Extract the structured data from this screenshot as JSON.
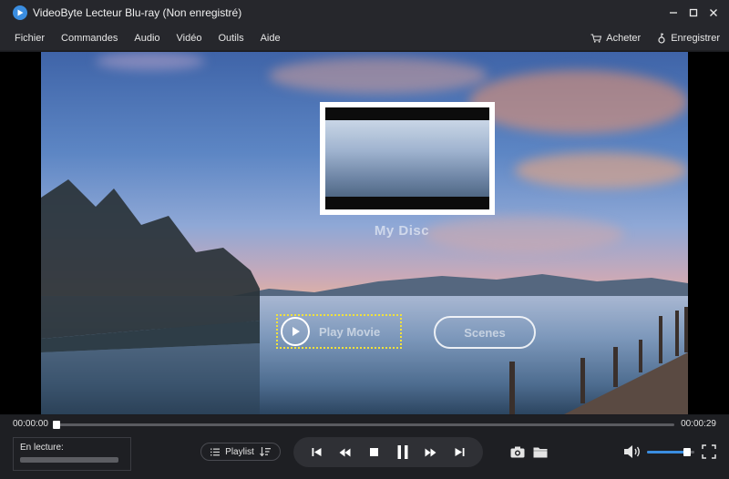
{
  "window": {
    "title": "VideoByte Lecteur Blu-ray (Non enregistré)",
    "controls": {
      "minimize": "—",
      "maximize": "☐",
      "close": "✕"
    }
  },
  "menu": {
    "items": [
      "Fichier",
      "Commandes",
      "Audio",
      "Vidéo",
      "Outils",
      "Aide"
    ],
    "buy_label": "Acheter",
    "register_label": "Enregistrer"
  },
  "disc_menu": {
    "title": "My Disc",
    "play_label": "Play Movie",
    "scenes_label": "Scenes"
  },
  "progress": {
    "current_time": "00:00:00",
    "total_time": "00:00:29",
    "fraction": 0.0
  },
  "now_playing": {
    "label": "En lecture:",
    "file": ""
  },
  "playlist_label": "Playlist",
  "volume": {
    "fraction": 0.85
  },
  "colors": {
    "accent": "#3a8de0",
    "highlight": "#f2e23a",
    "chrome": "#26272c"
  },
  "icons": {
    "logo": "play-logo-icon",
    "buy": "cart-icon",
    "register": "key-icon",
    "snapshot": "camera-icon",
    "folder": "folder-icon",
    "volume": "speaker-icon",
    "fullscreen": "fullscreen-icon"
  }
}
